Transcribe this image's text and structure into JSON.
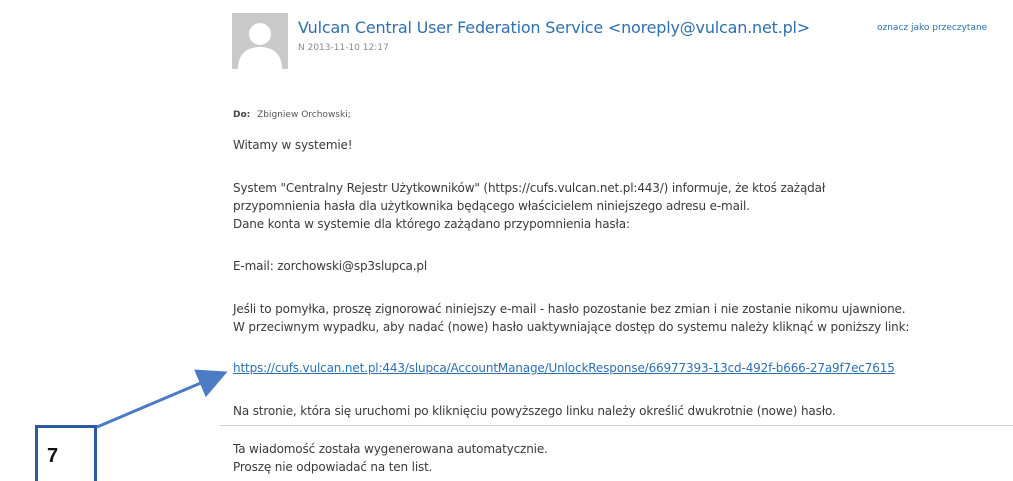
{
  "email": {
    "sender": "Vulcan Central User Federation Service <noreply@vulcan.net.pl>",
    "date": "N 2013-11-10 12:17",
    "mark_read": "oznacz jako przeczytane",
    "to_label": "Do:",
    "to_value": "Zbigniew Orchowski;",
    "body": {
      "greeting": "Witamy w systemie!",
      "p1_l1": "System \"Centralny Rejestr Użytkowników\" (https://cufs.vulcan.net.pl:443/) informuje, że ktoś zażądał",
      "p1_l2": "przypomnienia hasła dla użytkownika będącego właścicielem niniejszego adresu e-mail.",
      "p1_l3": "Dane konta w systemie dla którego zażądano przypomnienia hasła:",
      "email_line": "E-mail: zorchowski@sp3slupca.pl",
      "p2_l1": "Jeśli to pomyłka, proszę zignorować niniejszy e-mail - hasło pozostanie bez zmian i nie zostanie nikomu ujawnione.",
      "p2_l2": "W przeciwnym wypadku, aby nadać (nowe) hasło uaktywniające dostęp do systemu należy kliknąć w poniższy link:",
      "link": "https://cufs.vulcan.net.pl:443/slupca/AccountManage/UnlockResponse/66977393-13cd-492f-b666-27a9f7ec7615",
      "p3": "Na stronie, która się uruchomi po kliknięciu powyższego linku należy określić dwukrotnie (nowe) hasło.",
      "footer_l1": "Ta wiadomość została wygenerowana automatycznie.",
      "footer_l2": "Proszę nie odpowiadać na ten list."
    }
  },
  "annotation": {
    "number": "7",
    "color": "#2b5aa3"
  },
  "colors": {
    "link": "#2e6fb0",
    "avatar_bg": "#c9c9c9"
  },
  "icons": {
    "avatar": "person-silhouette-icon"
  }
}
